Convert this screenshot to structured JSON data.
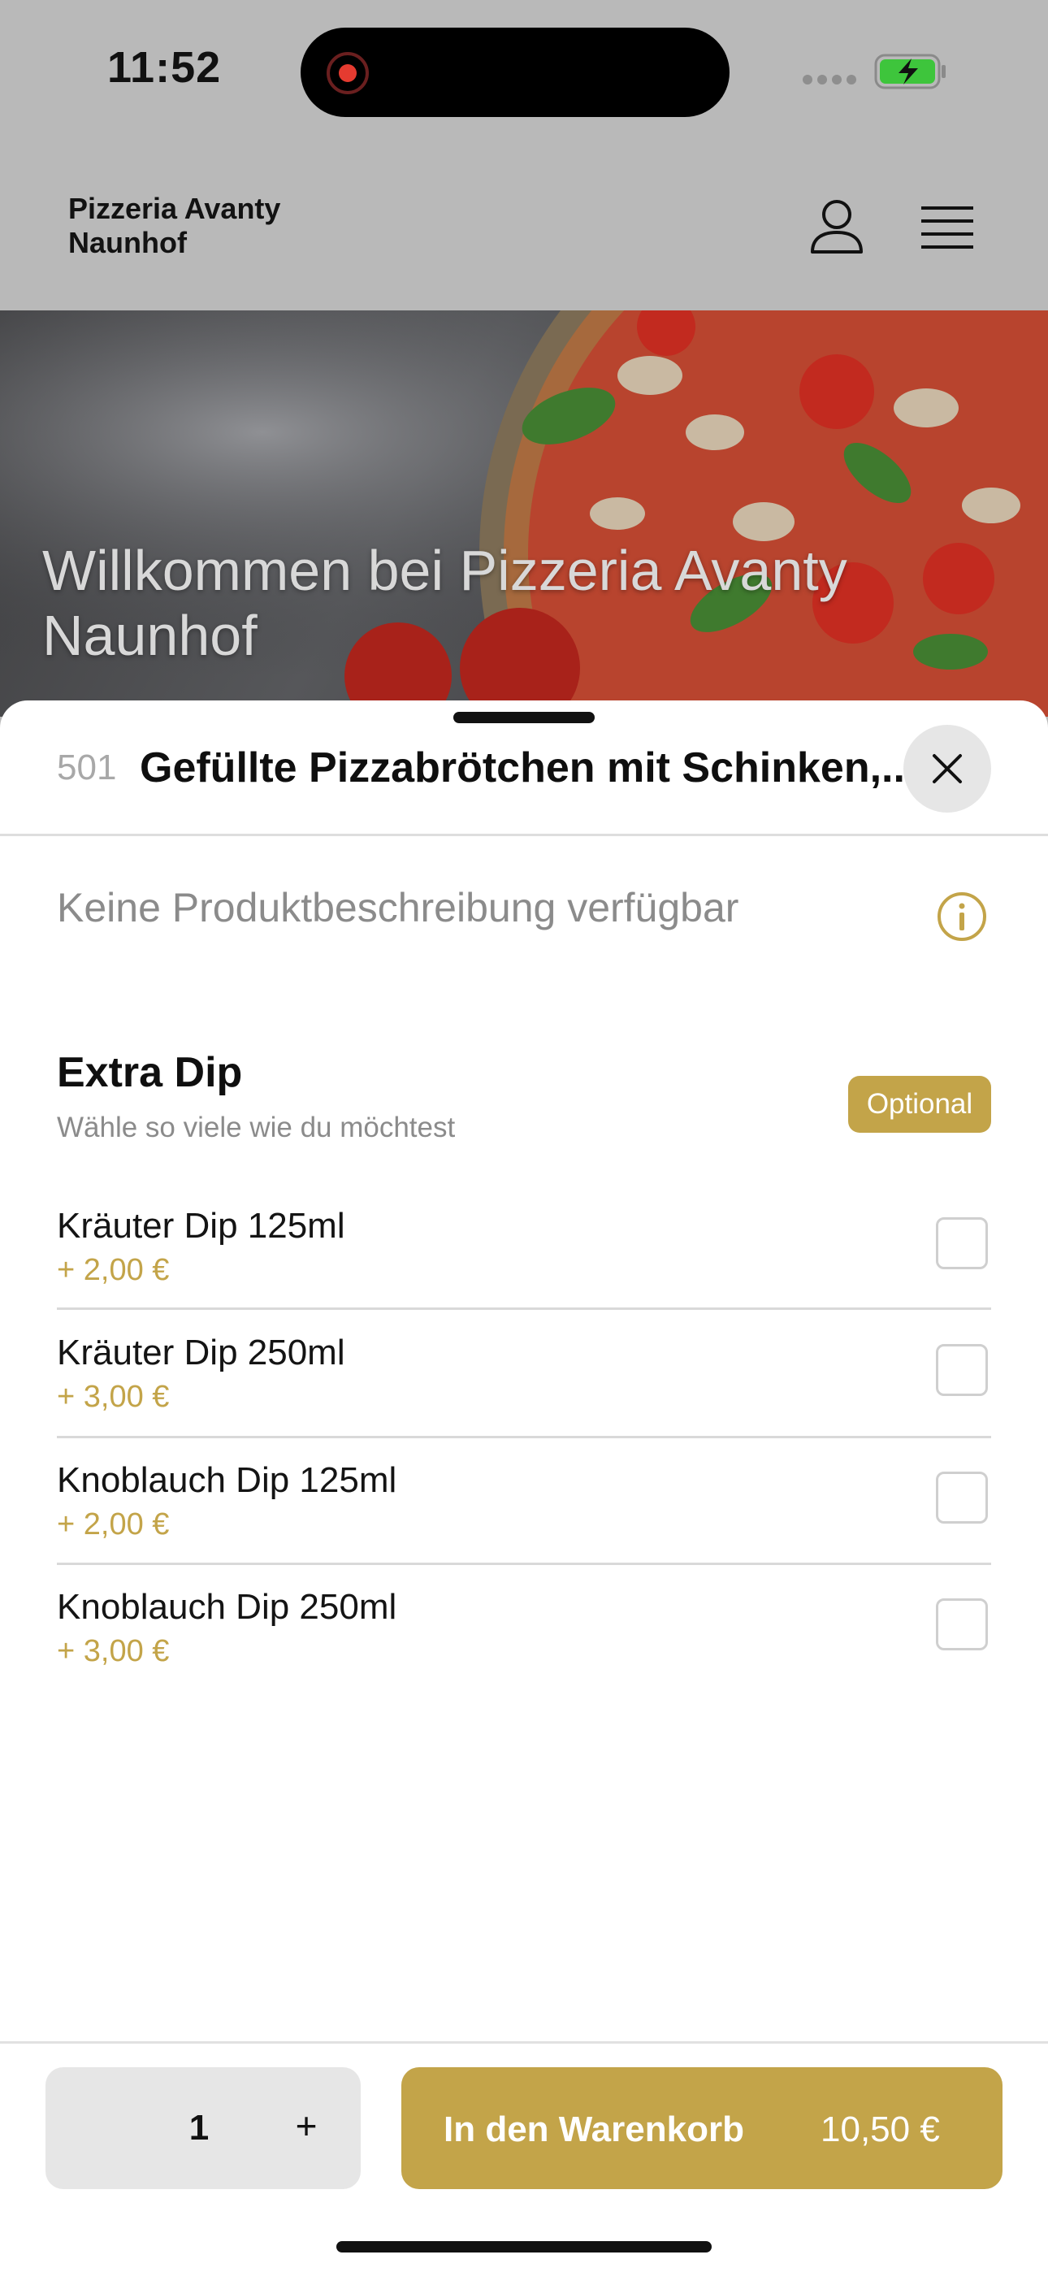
{
  "status_bar": {
    "time": "11:52"
  },
  "header": {
    "brand": "Pizzeria Avanty Naunhof",
    "icons": [
      "profile-icon",
      "menu-icon"
    ]
  },
  "hero": {
    "title": "Willkommen bei Pizzeria Avanty Naunhof"
  },
  "product": {
    "number": "501",
    "title": "Gefüllte Pizzabrötchen mit Schinken,...",
    "description": "Keine Produktbeschreibung verfügbar"
  },
  "option_group": {
    "title": "Extra Dip",
    "subtitle": "Wähle so viele wie du möchtest",
    "badge": "Optional",
    "items": [
      {
        "name": "Kräuter Dip 125ml",
        "price": "+ 2,00 €",
        "checked": false
      },
      {
        "name": "Kräuter Dip 250ml",
        "price": "+ 3,00 €",
        "checked": false
      },
      {
        "name": "Knoblauch Dip 125ml",
        "price": "+ 2,00 €",
        "checked": false
      },
      {
        "name": "Knoblauch Dip 250ml",
        "price": "+ 3,00 €",
        "checked": false
      }
    ]
  },
  "footer": {
    "quantity": "1",
    "plus": "+",
    "cart_label": "In den Warenkorb",
    "cart_price": "10,50 €"
  },
  "colors": {
    "accent": "#c3a449",
    "overlay": "#b9b9b9"
  }
}
